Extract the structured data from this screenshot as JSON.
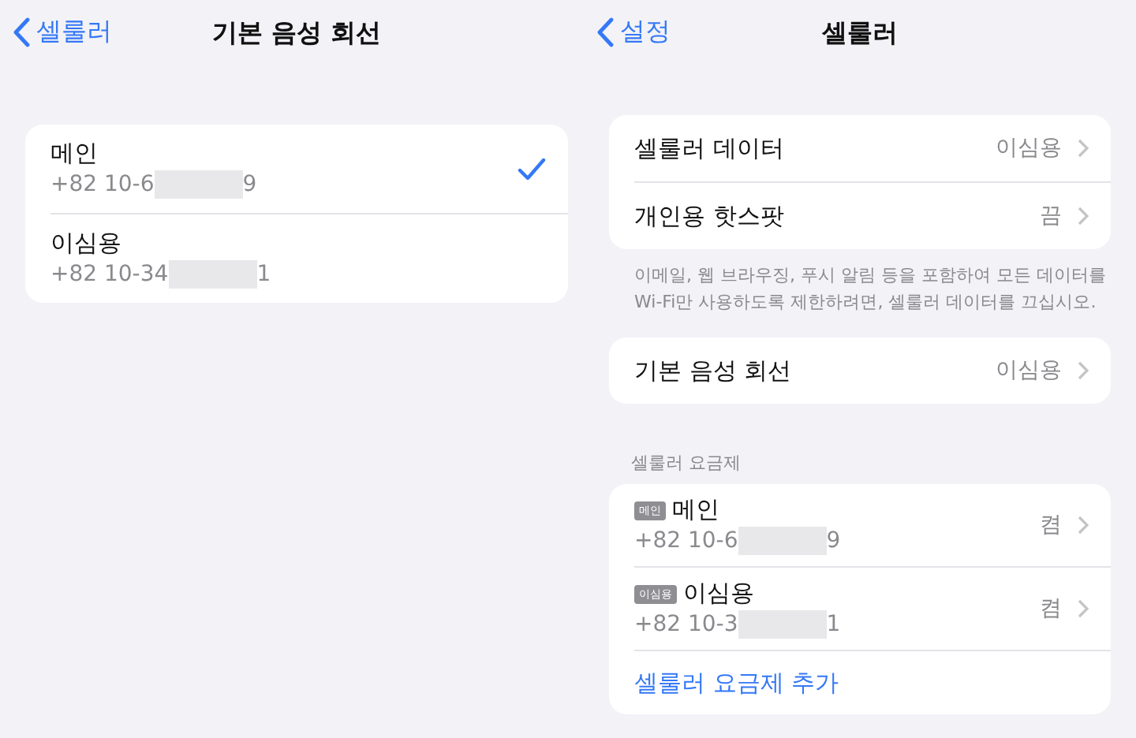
{
  "left_screen": {
    "nav": {
      "back": "셀룰러",
      "title": "기본 음성 회선"
    },
    "lines": [
      {
        "name": "메인",
        "number_start": "+82 10-6",
        "number_end": "9",
        "selected": true
      },
      {
        "name": "이심용",
        "number_start": "+82 10-34",
        "number_end": "1",
        "selected": false
      }
    ]
  },
  "right_screen": {
    "nav": {
      "back": "설정",
      "title": "셀룰러"
    },
    "data_group": [
      {
        "label": "셀룰러 데이터",
        "value": "이심용"
      },
      {
        "label": "개인용 핫스팟",
        "value": "끔"
      }
    ],
    "data_footer": "이메일, 웹 브라우징, 푸시 알림 등을 포함하여 모든 데이터를 Wi-Fi만 사용하도록 제한하려면, 셀룰러 데이터를 끄십시오.",
    "voice_group": [
      {
        "label": "기본 음성 회선",
        "value": "이심용"
      }
    ],
    "plans_header": "셀룰러 요금제",
    "plans": [
      {
        "badge": "메인",
        "name": "메인",
        "number_start": "+82 10-6",
        "number_end": "9",
        "value": "켬"
      },
      {
        "badge": "이심용",
        "name": "이심용",
        "number_start": "+82 10-3",
        "number_end": "1",
        "value": "켬"
      }
    ],
    "add_plan": "셀룰러 요금제 추가"
  }
}
